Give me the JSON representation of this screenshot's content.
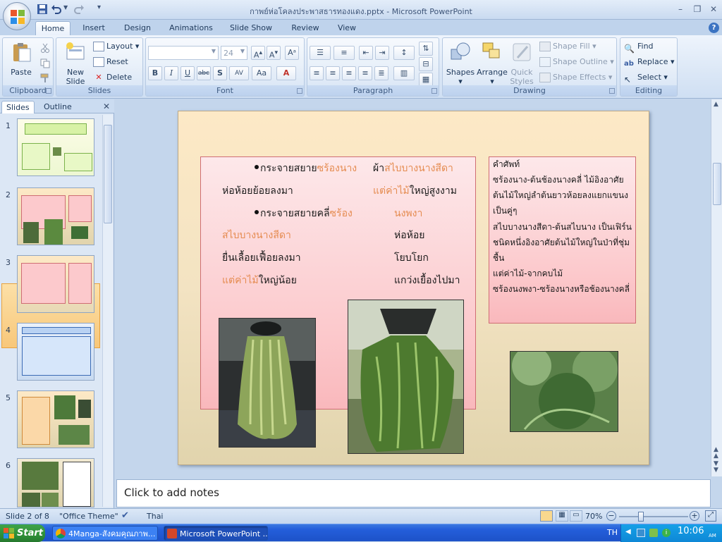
{
  "window": {
    "title": "กาพย์ห่อโคลงประพาสธารทองแดง.pptx - Microsoft PowerPoint",
    "controls": {
      "minimize": "–",
      "restore": "❐",
      "close": "✕"
    }
  },
  "ribbon": {
    "tabs": [
      "Home",
      "Insert",
      "Design",
      "Animations",
      "Slide Show",
      "Review",
      "View"
    ],
    "active_tab": "Home",
    "clipboard": {
      "label": "Clipboard",
      "paste": "Paste"
    },
    "slides": {
      "label": "Slides",
      "new_slide_line1": "New",
      "new_slide_line2": "Slide",
      "layout": "Layout",
      "reset": "Reset",
      "delete": "Delete"
    },
    "font": {
      "label": "Font",
      "font_name": "",
      "font_size": "24"
    },
    "paragraph": {
      "label": "Paragraph"
    },
    "drawing": {
      "label": "Drawing",
      "shapes": "Shapes",
      "arrange": "Arrange",
      "quick_styles_line1": "Quick",
      "quick_styles_line2": "Styles",
      "shape_fill": "Shape Fill",
      "shape_outline": "Shape Outline",
      "shape_effects": "Shape Effects"
    },
    "editing": {
      "label": "Editing",
      "find": "Find",
      "replace": "Replace",
      "select": "Select"
    }
  },
  "panel": {
    "tabs": [
      "Slides",
      "Outline"
    ],
    "active": "Slides",
    "slide_numbers": [
      "1",
      "2",
      "3",
      "4",
      "5",
      "6"
    ],
    "selected_slide": 2
  },
  "slide": {
    "poem_lines": [
      {
        "left": "กระจายสยาย",
        "left_orange": "ซร้องนาง",
        "right": "ผ้า",
        "right_orange": "สไบบางนางสีดา"
      },
      {
        "left": "ห่อห้อยย้อยลงมา",
        "right_orange": "แต่ค่าไม้",
        "right": "ใหญ่สูงงาม"
      },
      {
        "left": "กระจายสยายคลี่",
        "left_orange": "ซร้อง",
        "right_orange": "นงพงา"
      },
      {
        "left_orange": "สไบบางนางสีดา",
        "right": "ห่อห้อย"
      },
      {
        "left": "ยื่นเลื้อยเฟื้อยลงมา",
        "right": "โยบโยก"
      },
      {
        "left_orange": "แต่ค่าไม้",
        "left": "ใหญ่น้อย",
        "right": "แกว่งเยื้องไปมา"
      }
    ],
    "vocab_lines": [
      "คำศัพท์",
      "ซร้องนาง-ต้นช้องนางคลี่ ไม้อิงอาศัย",
      "ต้นไม้ใหญ่ลำต้นยาวห้อยลงแยกแขนง",
      "เป็นคู่ๆ",
      "สไบบางนางสีดา-ต้นสไบนาง เป็นเฟิร์น",
      "ชนิดหนึ่งอิงอาศัยต้นไม้ใหญ่ในป่าที่ชุ่ม",
      "ชื้น",
      "แต่ค่าไม้-จากคบไม้",
      "ซร้องนงพงา-ซร้องนางหรือช้องนางคลี่"
    ]
  },
  "notes": {
    "placeholder": "Click to add notes"
  },
  "status": {
    "slide_info": "Slide 2 of 8",
    "theme": "\"Office Theme\"",
    "language": "Thai",
    "zoom": "70%"
  },
  "taskbar": {
    "start": "Start",
    "tasks": [
      "4Manga-สังคมคุณภาพ...",
      "Microsoft PowerPoint ..."
    ],
    "tray_lang": "TH",
    "clock": "10:06",
    "clock_ampm": "AM"
  },
  "colors": {
    "accent_orange": "#e58c51",
    "pink_box_border": "#cf6d74",
    "selection": "#f8c77a"
  }
}
